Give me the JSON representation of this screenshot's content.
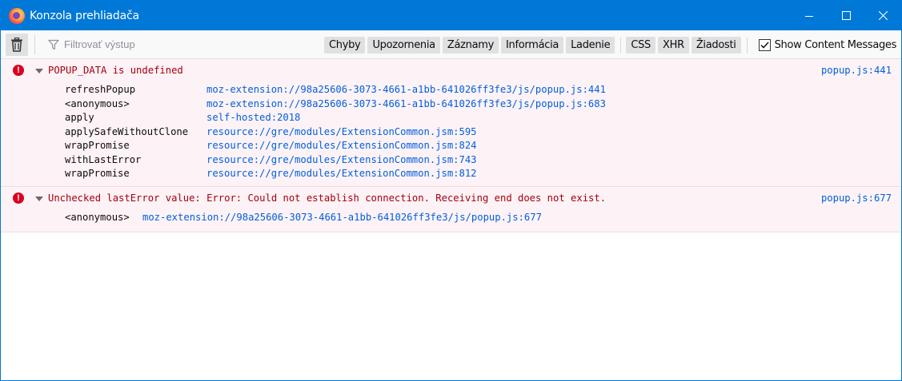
{
  "window": {
    "title": "Konzola prehliadača",
    "icon": "firefox-icon"
  },
  "toolbar": {
    "filter_placeholder": "Filtrovať výstup",
    "filters": [
      {
        "label": "Chyby",
        "name": "filter-errors"
      },
      {
        "label": "Upozornenia",
        "name": "filter-warnings"
      },
      {
        "label": "Záznamy",
        "name": "filter-logs"
      },
      {
        "label": "Informácia",
        "name": "filter-info"
      },
      {
        "label": "Ladenie",
        "name": "filter-debug"
      }
    ],
    "filters2": [
      {
        "label": "CSS",
        "name": "filter-css"
      },
      {
        "label": "XHR",
        "name": "filter-xhr"
      },
      {
        "label": "Žiadosti",
        "name": "filter-requests"
      }
    ],
    "show_content_messages": "Show Content Messages",
    "show_content_checked": true
  },
  "messages": [
    {
      "text": "POPUP_DATA is undefined",
      "location": "popup.js:441",
      "frames": [
        {
          "fn": "refreshPopup",
          "src": "moz-extension://98a25606-3073-4661-a1bb-641026ff3fe3/js/popup.js:441"
        },
        {
          "fn": "<anonymous>",
          "src": "moz-extension://98a25606-3073-4661-a1bb-641026ff3fe3/js/popup.js:683"
        },
        {
          "fn": "apply",
          "src": "self-hosted:2018"
        },
        {
          "fn": "applySafeWithoutClone",
          "src": "resource://gre/modules/ExtensionCommon.jsm:595"
        },
        {
          "fn": "wrapPromise",
          "src": "resource://gre/modules/ExtensionCommon.jsm:824"
        },
        {
          "fn": "withLastError",
          "src": "resource://gre/modules/ExtensionCommon.jsm:743"
        },
        {
          "fn": "wrapPromise",
          "src": "resource://gre/modules/ExtensionCommon.jsm:812"
        }
      ]
    },
    {
      "text": "Unchecked lastError value: Error: Could not establish connection. Receiving end does not exist.",
      "location": "popup.js:677",
      "frames": [
        {
          "fn": "<anonymous>",
          "src": "moz-extension://98a25606-3073-4661-a1bb-641026ff3fe3/js/popup.js:677"
        }
      ]
    }
  ],
  "colors": {
    "titlebar": "#0078d7",
    "error_text": "#a4000f",
    "link": "#0060df",
    "error_bg": "#fdf2f5"
  }
}
